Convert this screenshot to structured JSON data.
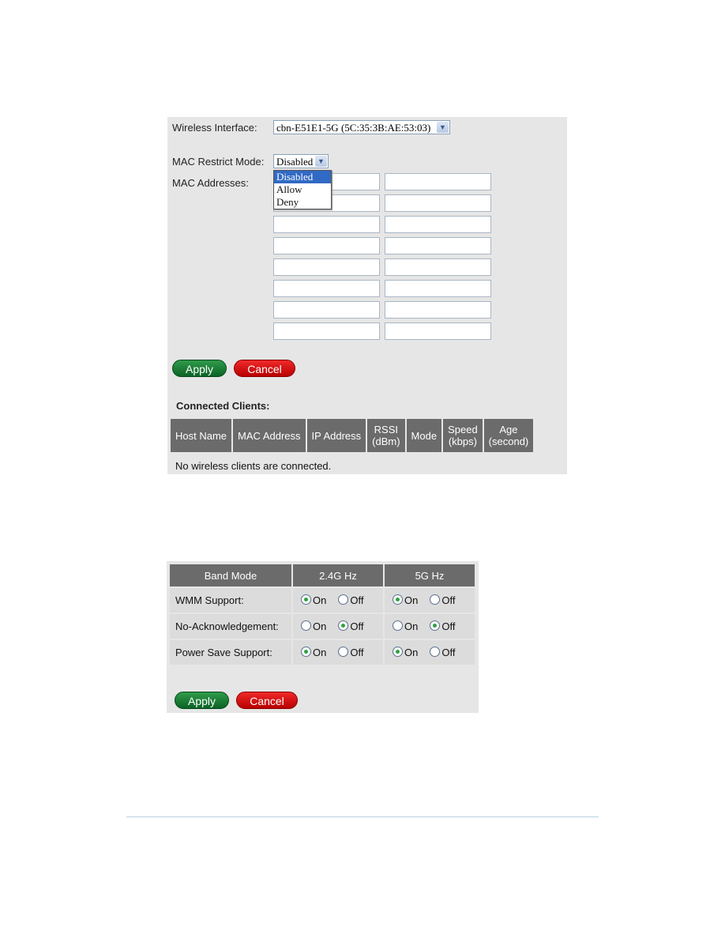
{
  "mac_filter": {
    "wireless_interface_label": "Wireless Interface:",
    "wireless_interface_value": "cbn-E51E1-5G (5C:35:3B:AE:53:03)",
    "mac_restrict_mode_label": "MAC Restrict Mode:",
    "mac_restrict_mode_value": "Disabled",
    "mac_restrict_mode_options": [
      "Disabled",
      "Allow",
      "Deny"
    ],
    "mac_addresses_label": "MAC Addresses:",
    "mac_addresses": [
      "",
      "",
      "",
      "",
      "",
      "",
      "",
      "",
      "",
      "",
      "",
      "",
      "",
      "",
      "",
      ""
    ],
    "apply_label": "Apply",
    "cancel_label": "Cancel",
    "connected_clients_title": "Connected Clients:",
    "clients_columns": [
      {
        "line1": "Host Name",
        "line2": ""
      },
      {
        "line1": "MAC Address",
        "line2": ""
      },
      {
        "line1": "IP Address",
        "line2": ""
      },
      {
        "line1": "RSSI",
        "line2": "(dBm)"
      },
      {
        "line1": "Mode",
        "line2": ""
      },
      {
        "line1": "Speed",
        "line2": "(kbps)"
      },
      {
        "line1": "Age",
        "line2": "(second)"
      }
    ],
    "no_clients_message": "No wireless clients are connected."
  },
  "band_mode": {
    "columns": [
      "Band Mode",
      "2.4G Hz",
      "5G Hz"
    ],
    "on_label": "On",
    "off_label": "Off",
    "rows": [
      {
        "label": "WMM Support:",
        "band_24": "On",
        "band_5": "On"
      },
      {
        "label": "No-Acknowledgement:",
        "band_24": "Off",
        "band_5": "Off"
      },
      {
        "label": "Power Save Support:",
        "band_24": "On",
        "band_5": "On"
      }
    ],
    "apply_label": "Apply",
    "cancel_label": "Cancel"
  }
}
